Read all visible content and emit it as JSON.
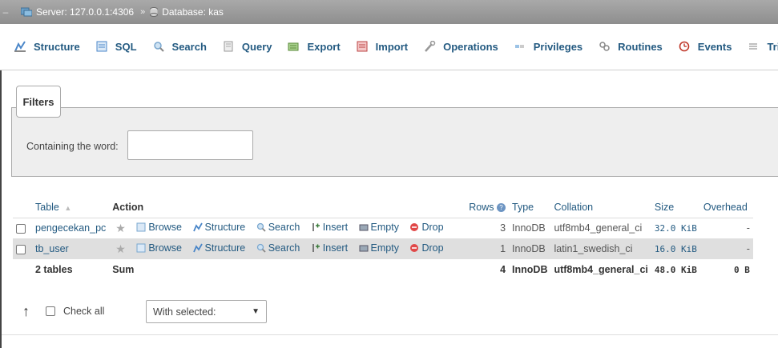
{
  "breadcrumb": {
    "server": "Server: 127.0.0.1:4306",
    "separator": "»",
    "database": "Database: kas"
  },
  "tabs": [
    {
      "label": "Structure",
      "icon": "structure-icon"
    },
    {
      "label": "SQL",
      "icon": "sql-icon"
    },
    {
      "label": "Search",
      "icon": "search-icon"
    },
    {
      "label": "Query",
      "icon": "query-icon"
    },
    {
      "label": "Export",
      "icon": "export-icon"
    },
    {
      "label": "Import",
      "icon": "import-icon"
    },
    {
      "label": "Operations",
      "icon": "wrench-icon"
    },
    {
      "label": "Privileges",
      "icon": "privileges-icon"
    },
    {
      "label": "Routines",
      "icon": "routines-icon"
    },
    {
      "label": "Events",
      "icon": "events-icon"
    },
    {
      "label": "Trigg",
      "icon": "triggers-icon"
    }
  ],
  "filters": {
    "legend": "Filters",
    "label": "Containing the word:",
    "value": ""
  },
  "table": {
    "headers": {
      "table": "Table",
      "sort": "▲",
      "action": "Action",
      "rows": "Rows",
      "type": "Type",
      "collation": "Collation",
      "size": "Size",
      "overhead": "Overhead"
    },
    "actions": {
      "browse": "Browse",
      "structure": "Structure",
      "search": "Search",
      "insert": "Insert",
      "empty": "Empty",
      "drop": "Drop"
    },
    "rows": [
      {
        "name": "pengecekan_pc",
        "rows": "3",
        "type": "InnoDB",
        "collation": "utf8mb4_general_ci",
        "size": "32.0 KiB",
        "overhead": "-"
      },
      {
        "name": "tb_user",
        "rows": "1",
        "type": "InnoDB",
        "collation": "latin1_swedish_ci",
        "size": "16.0 KiB",
        "overhead": "-"
      }
    ],
    "footer": {
      "tables": "2 tables",
      "sum": "Sum",
      "rows": "4",
      "type": "InnoDB",
      "collation": "utf8mb4_general_ci",
      "size": "48.0 KiB",
      "overhead": "0 B"
    }
  },
  "bottom": {
    "check_all": "Check all",
    "with_selected": "With selected:"
  },
  "colors": {
    "link": "#235a81",
    "breadcrumb_bg": "#9a9a9a",
    "filters_bg": "#eeeeee",
    "alt_row": "#dfdfdf"
  }
}
